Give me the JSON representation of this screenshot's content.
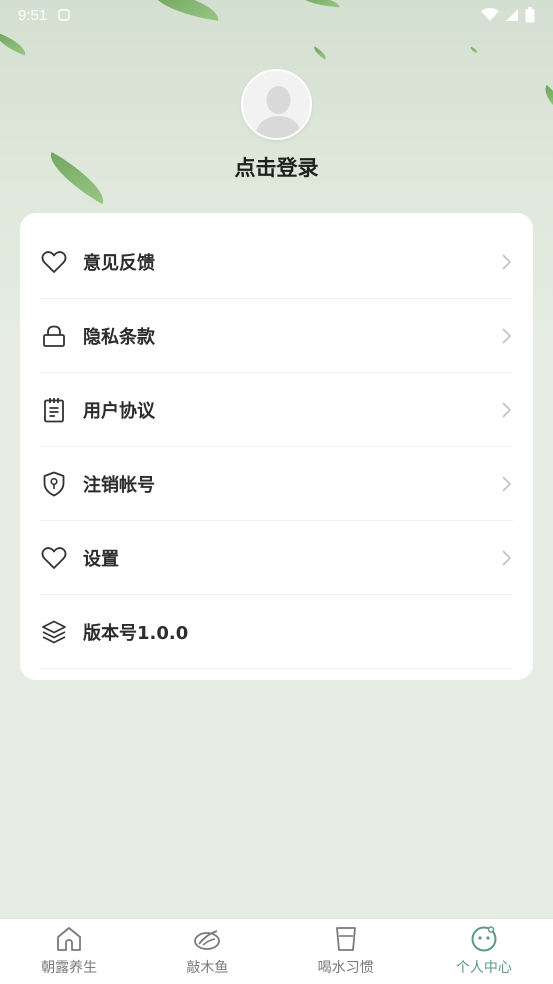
{
  "status_bar": {
    "time": "9:51"
  },
  "profile": {
    "login_label": "点击登录"
  },
  "menu": {
    "items": [
      {
        "label": "意见反馈",
        "icon": "heart-icon"
      },
      {
        "label": "隐私条款",
        "icon": "lock-icon"
      },
      {
        "label": "用户协议",
        "icon": "clipboard-icon"
      },
      {
        "label": "注销帐号",
        "icon": "shield-icon"
      },
      {
        "label": "设置",
        "icon": "heart-icon"
      },
      {
        "label": "版本号1.0.0",
        "icon": "layers-icon"
      }
    ]
  },
  "tabbar": {
    "tabs": [
      {
        "label": "朝露养生",
        "icon": "home-icon"
      },
      {
        "label": "敲木鱼",
        "icon": "wooden-fish-icon"
      },
      {
        "label": "喝水习惯",
        "icon": "cup-icon"
      },
      {
        "label": "个人中心",
        "icon": "smile-face-icon",
        "active": true
      }
    ]
  },
  "colors": {
    "accent": "#5d9a82",
    "card": "#ffffff",
    "background": "#e6ece4"
  }
}
